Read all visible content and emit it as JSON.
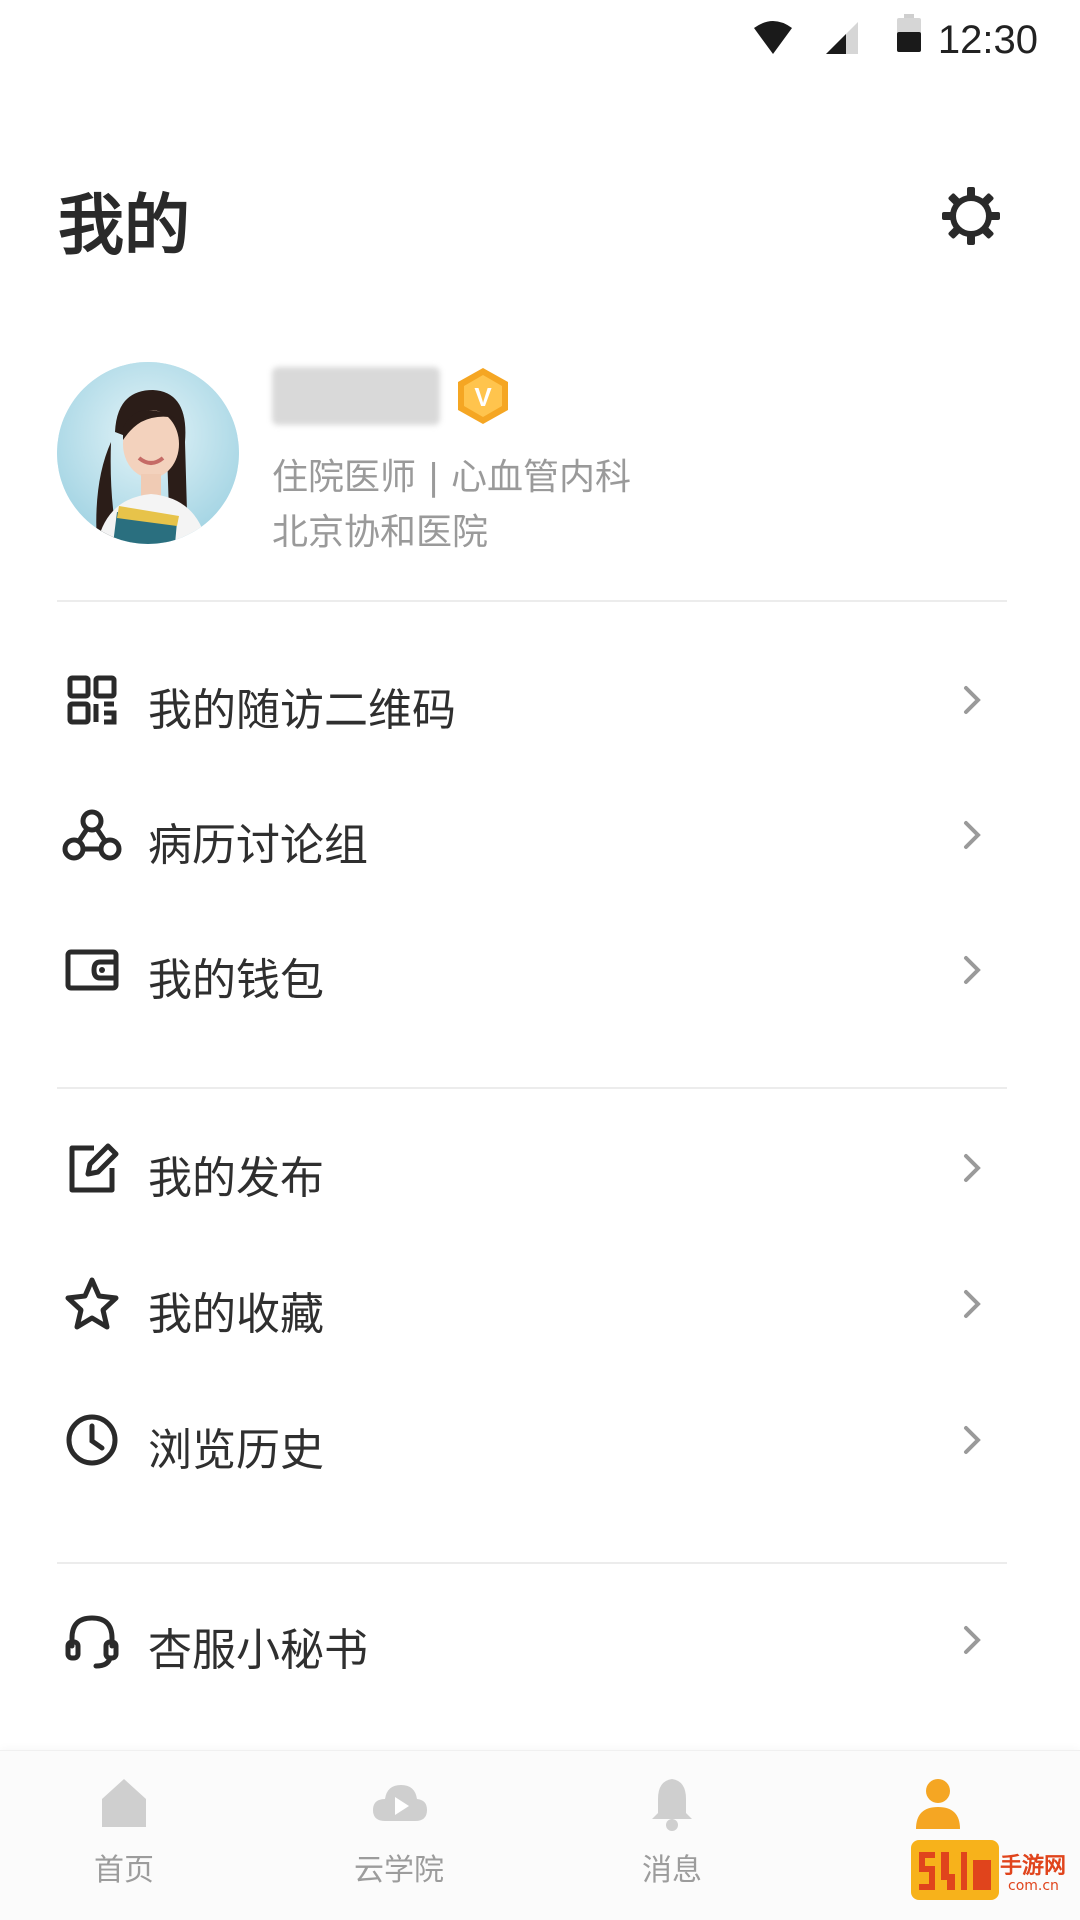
{
  "status_bar": {
    "time": "12:30",
    "icons": [
      "wifi-icon",
      "signal-icon",
      "battery-icon"
    ]
  },
  "header": {
    "title": "我的",
    "settings_icon": "gear-icon"
  },
  "profile": {
    "role": "住院医师 | 心血管内科",
    "hospital": "北京协和医院",
    "badge": "V",
    "badge_color": "#F5A623"
  },
  "menu": {
    "groups": [
      [
        {
          "label": "我的随访二维码",
          "icon": "qr-code-icon"
        },
        {
          "label": "病历讨论组",
          "icon": "group-icon"
        },
        {
          "label": "我的钱包",
          "icon": "wallet-icon"
        }
      ],
      [
        {
          "label": "我的发布",
          "icon": "edit-icon"
        },
        {
          "label": "我的收藏",
          "icon": "star-icon"
        },
        {
          "label": "浏览历史",
          "icon": "clock-icon"
        }
      ],
      [
        {
          "label": "杏服小秘书",
          "icon": "headset-icon"
        }
      ]
    ]
  },
  "bottom_nav": {
    "items": [
      {
        "label": "首页",
        "icon": "home-icon"
      },
      {
        "label": "云学院",
        "icon": "cloud-play-icon"
      },
      {
        "label": "消息",
        "icon": "bell-icon"
      },
      {
        "label": "",
        "icon": "person-icon"
      }
    ],
    "active_index": 3,
    "active_color": "#F5A623",
    "inactive_color": "#CFCFCF"
  },
  "watermark": {
    "text": "手游网",
    "sub": "com.cn"
  }
}
